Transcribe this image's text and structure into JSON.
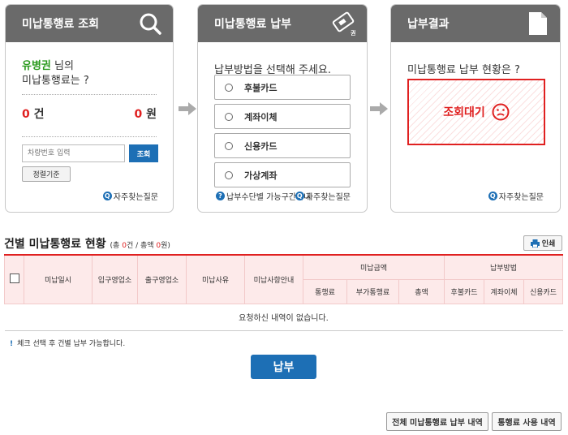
{
  "panels": {
    "inquiry": {
      "title": "미납통행료 조회",
      "name": "유병권",
      "name_suffix": " 님의",
      "line2": "미납통행료는 ?",
      "count": "0",
      "count_unit": " 건",
      "amount": "0",
      "amount_unit": " 원",
      "car_placeholder": "차량번호 입력",
      "search_label": "조회",
      "standard_label": "정렬기준",
      "faq_label": "자주찾는질문",
      "icon": "search-icon"
    },
    "payment": {
      "title": "미납통행료 납부",
      "prompt": "납부방법을 선택해 주세요.",
      "options": [
        "후불카드",
        "계좌이체",
        "신용카드",
        "가상계좌"
      ],
      "guide_label": "납부수단별 가능구간안내",
      "faq_label": "자주찾는질문",
      "icon": "ticket-icon",
      "icon_text": "권"
    },
    "result": {
      "title": "납부결과",
      "prompt": "미납통행료 납부 현황은 ?",
      "status": "조회대기",
      "faq_label": "자주찾는질문",
      "icon": "document-icon"
    }
  },
  "section": {
    "title": "건별 미납통행료 현황",
    "summary_pre": "(총 ",
    "count": "0",
    "summary_mid": "건 / 총액 ",
    "amount": "0",
    "summary_post": "원)",
    "print_label": "인쇄"
  },
  "table": {
    "headers": {
      "date": "미납일시",
      "entry": "입구영업소",
      "exit": "출구영업소",
      "reason": "미납사유",
      "guide": "미납사항안내",
      "amount_group": "미납금액",
      "method_group": "납부방법"
    },
    "amount_sub": [
      "통행료",
      "부가통행료",
      "총액"
    ],
    "method_sub": [
      "후불카드",
      "계좌이체",
      "신용카드"
    ],
    "empty_message": "요청하신 내역이 없습니다."
  },
  "note": "체크 선택 후 건별 납부 가능합니다.",
  "pay_label": "납부",
  "bottom_buttons": [
    "전체 미납통행료 납부 내역",
    "통행료 사용 내역"
  ],
  "colors": {
    "header_gray": "#6a6a6a",
    "accent_red": "#e02020",
    "primary_blue": "#1d6fb5",
    "name_green": "#2b9a1e"
  }
}
